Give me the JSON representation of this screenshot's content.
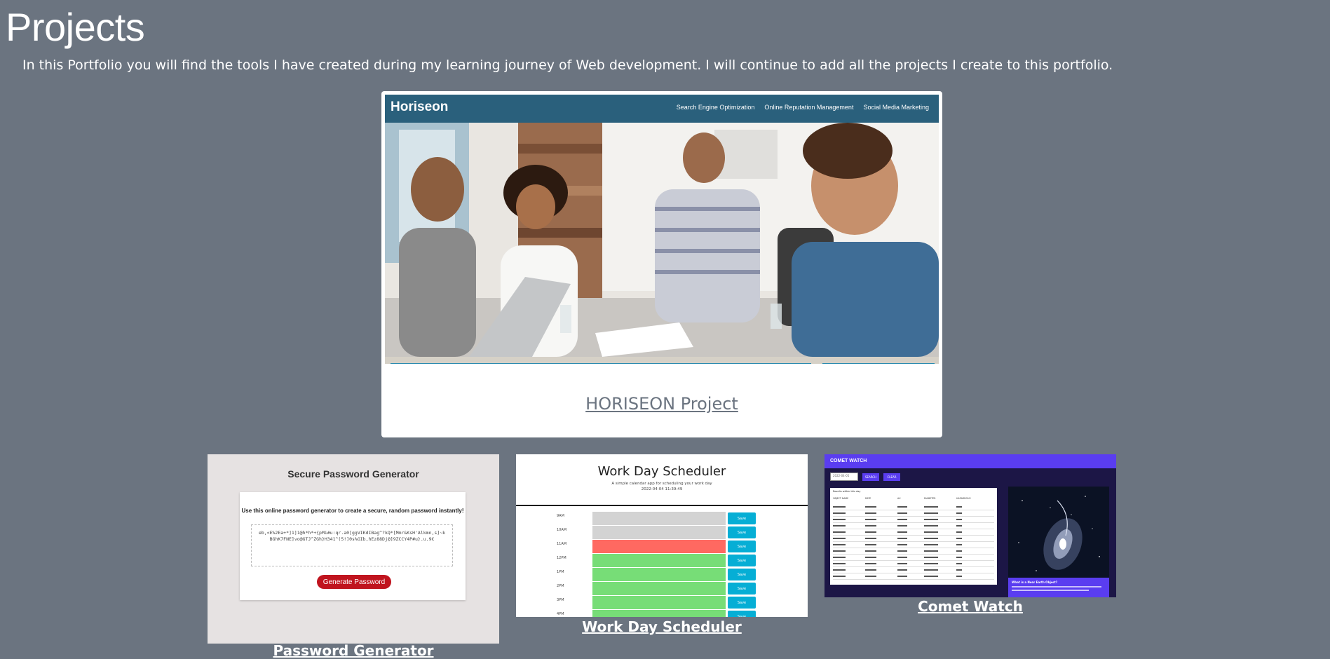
{
  "page": {
    "title": "Projects",
    "intro": "In this Portfolio you will find the tools I have created during my learning journey of Web development. I will continue to add all the projects I create to this portfolio."
  },
  "featured": {
    "link_label": "HORISEON Project",
    "screenshot": {
      "logo": "Horiseon",
      "nav": [
        "Search Engine Optimization",
        "Online Reputation Management",
        "Social Media Marketing"
      ]
    }
  },
  "password_generator": {
    "link_label": "Password Generator",
    "screenshot": {
      "title": "Secure Password Generator",
      "instruction": "Use this online password generator to create a secure, random password instantly!",
      "password": "eb,<E%2Ea+*]1]1@h*h*+{pMi#u:qr.a0[ggVIKdIBag^?kQ*[Mmr&KsH'Alkmn,s]~kBGhK7FNE]vo@GTJ^ZGh}H341^(5!]0s%GIb,hEz88Dj@]9ZCCY4P#u}.u.9€",
      "button": "Generate Password"
    }
  },
  "work_day_scheduler": {
    "link_label": "Work Day Scheduler",
    "screenshot": {
      "title": "Work Day Scheduler",
      "subtitle": "A simple calendar app for scheduling your work day",
      "date": "2022-04-04 11:39:49",
      "save_label": "Save",
      "hours": [
        {
          "label": "9AM",
          "state": "past"
        },
        {
          "label": "10AM",
          "state": "past"
        },
        {
          "label": "11AM",
          "state": "present"
        },
        {
          "label": "12PM",
          "state": "future"
        },
        {
          "label": "1PM",
          "state": "future"
        },
        {
          "label": "2PM",
          "state": "future"
        },
        {
          "label": "3PM",
          "state": "future"
        },
        {
          "label": "4PM",
          "state": "future"
        }
      ]
    }
  },
  "comet_watch": {
    "link_label": "Comet Watch",
    "screenshot": {
      "brand": "COMET WATCH",
      "input_placeholder": "2022-04-05",
      "search_label": "SEARCH",
      "clear_label": "CLEAR",
      "table_caption": "Results within this day",
      "columns": [
        "OBJECT NAME",
        "DATE",
        "AU",
        "DIAMETER",
        "HAZARDOUS"
      ],
      "row_count": 12,
      "info_title": "What is a Near Earth Object?"
    }
  },
  "colors": {
    "background": "#6b7480",
    "horiseon_header": "#2a607c",
    "password_button": "#c0141e",
    "past": "#d3d3d3",
    "present": "#ff6961",
    "future": "#77dd77",
    "save_button": "#06aed5",
    "comet_accent": "#5a3df0"
  }
}
